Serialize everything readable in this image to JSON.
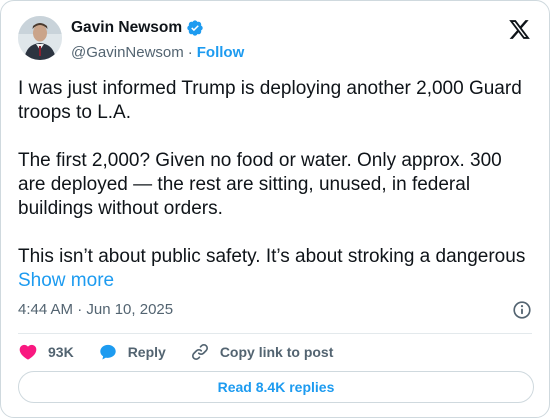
{
  "author": {
    "name": "Gavin Newsom",
    "handle": "@GavinNewsom",
    "separator": "·",
    "follow_label": "Follow",
    "avatar_icon": "avatar-photo",
    "verified_icon": "verified-badge-icon"
  },
  "platform_icon": "x-logo-icon",
  "post": {
    "paragraph_1": "I was just informed Trump is deploying another 2,000 Guard troops to L.A.",
    "paragraph_2": "The first 2,000? Given no food or water. Only approx. 300 are deployed — the rest are sitting, unused, in federal buildings without orders.",
    "paragraph_3": "This isn’t about public safety. It’s about stroking a dangerous",
    "show_more": "Show more"
  },
  "timestamp": "4:44 AM · Jun 10, 2025",
  "actions": {
    "likes": "93K",
    "reply_label": "Reply",
    "copy_link_label": "Copy link to post"
  },
  "read_replies_label": "Read 8.4K replies",
  "colors": {
    "accent": "#1d9bf0",
    "like": "#f91880",
    "text": "#0f1419",
    "muted": "#536471"
  }
}
